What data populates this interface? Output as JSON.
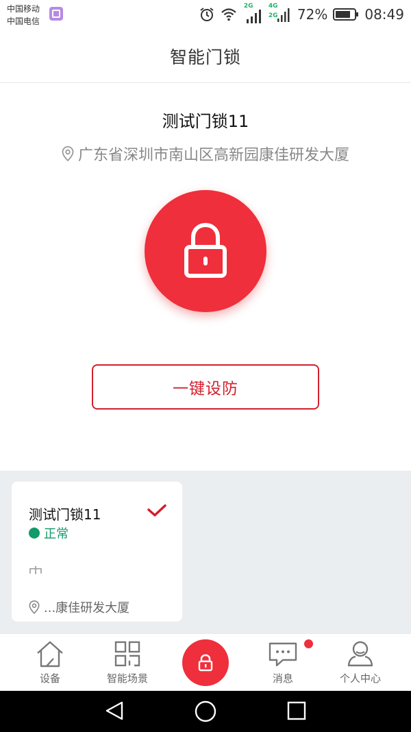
{
  "status_bar": {
    "carrier_1": "中国移动",
    "carrier_2": "中国电信",
    "network_label_1": "2G",
    "network_label_2a": "4G",
    "network_label_2b": "2G",
    "battery": "72%",
    "time": "08:49"
  },
  "app_bar": {
    "title": "智能门锁"
  },
  "device": {
    "name": "测试门锁11",
    "address": "广东省深圳市南山区高新园康佳研发大厦",
    "lock_icon": "lock-icon",
    "arm_button_label": "一键设防"
  },
  "device_card": {
    "name": "测试门锁11",
    "status": "正常",
    "status_color": "#129a6a",
    "address_short": "...康佳研发大厦"
  },
  "tabs": [
    {
      "label": "设备",
      "icon": "home-icon"
    },
    {
      "label": "智能场景",
      "icon": "grid-icon"
    },
    {
      "label": "",
      "icon": "lock-icon"
    },
    {
      "label": "消息",
      "icon": "message-icon"
    },
    {
      "label": "个人中心",
      "icon": "user-icon"
    }
  ],
  "colors": {
    "accent": "#ef2f3b",
    "accent_border": "#d21f2c",
    "ok": "#129a6a",
    "panel_bg": "#eaeef1"
  }
}
